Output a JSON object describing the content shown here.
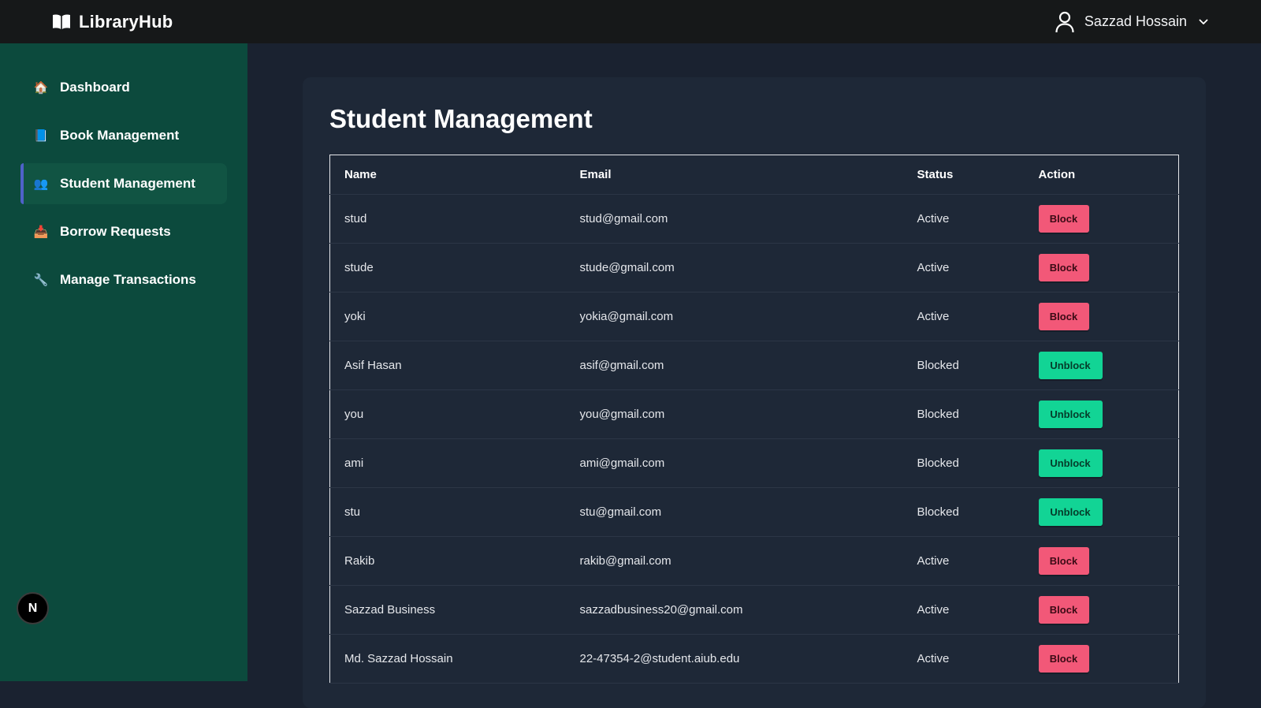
{
  "app": {
    "name": "LibraryHub"
  },
  "user": {
    "name": "Sazzad Hossain"
  },
  "sidebar": {
    "items": [
      {
        "label": "Dashboard",
        "icon": "🏠",
        "icon_name": "home-icon",
        "active": false
      },
      {
        "label": "Book Management",
        "icon": "📘",
        "icon_name": "book-icon",
        "active": false
      },
      {
        "label": "Student Management",
        "icon": "👥",
        "icon_name": "users-icon",
        "active": true
      },
      {
        "label": "Borrow Requests",
        "icon": "📥",
        "icon_name": "inbox-tray-icon",
        "active": false
      },
      {
        "label": "Manage Transactions",
        "icon": "🔧",
        "icon_name": "wrench-icon",
        "active": false
      }
    ],
    "badge": "N"
  },
  "page": {
    "title": "Student Management"
  },
  "table": {
    "columns": [
      "Name",
      "Email",
      "Status",
      "Action"
    ],
    "rows": [
      {
        "name": "stud",
        "email": "stud@gmail.com",
        "status": "Active",
        "action": "Block"
      },
      {
        "name": "stude",
        "email": "stude@gmail.com",
        "status": "Active",
        "action": "Block"
      },
      {
        "name": "yoki",
        "email": "yokia@gmail.com",
        "status": "Active",
        "action": "Block"
      },
      {
        "name": "Asif Hasan",
        "email": "asif@gmail.com",
        "status": "Blocked",
        "action": "Unblock"
      },
      {
        "name": "you",
        "email": "you@gmail.com",
        "status": "Blocked",
        "action": "Unblock"
      },
      {
        "name": "ami",
        "email": "ami@gmail.com",
        "status": "Blocked",
        "action": "Unblock"
      },
      {
        "name": "stu",
        "email": "stu@gmail.com",
        "status": "Blocked",
        "action": "Unblock"
      },
      {
        "name": "Rakib",
        "email": "rakib@gmail.com",
        "status": "Active",
        "action": "Block"
      },
      {
        "name": "Sazzad Business",
        "email": "sazzadbusiness20@gmail.com",
        "status": "Active",
        "action": "Block"
      },
      {
        "name": "Md. Sazzad Hossain",
        "email": "22-47354-2@student.aiub.edu",
        "status": "Active",
        "action": "Block"
      }
    ]
  },
  "colors": {
    "topbar": "#161819",
    "sidebar": "#0c4a3d",
    "sidebar_active": "#115443",
    "active_accent": "#4f62c9",
    "main_bg": "#1a2230",
    "card_bg": "#1e2837",
    "block_button": "#f25878",
    "unblock_button": "#12d495"
  }
}
